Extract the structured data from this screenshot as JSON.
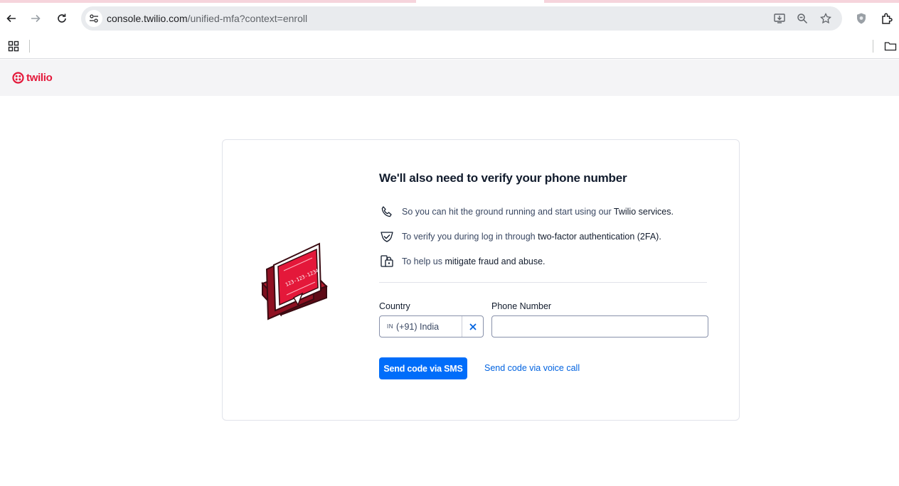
{
  "browser": {
    "url_host": "console.twilio.com",
    "url_path": "/unified-mfa?context=enroll"
  },
  "app": {
    "logo_text": "twilio",
    "brand_color": "#e4183a"
  },
  "card": {
    "title": "We'll also need to verify your phone number",
    "bullets": [
      {
        "icon": "phone-icon",
        "text": "So you can hit the ground running and start using our ",
        "strong": "Twilio services."
      },
      {
        "icon": "shield-check-icon",
        "text": "To verify you during log in through ",
        "strong": "two-factor authentication (2FA)."
      },
      {
        "icon": "fraud-lock-icon",
        "text": "To help us ",
        "strong": "mitigate fraud and abuse."
      }
    ],
    "illustration_number": "123-123-1234",
    "country_label": "Country",
    "country_flag": "IN",
    "country_value": "(+91) India",
    "phone_label": "Phone Number",
    "phone_value": "",
    "sms_button": "Send code via SMS",
    "voice_link": "Send code via voice call",
    "accent_color": "#006dfa"
  }
}
